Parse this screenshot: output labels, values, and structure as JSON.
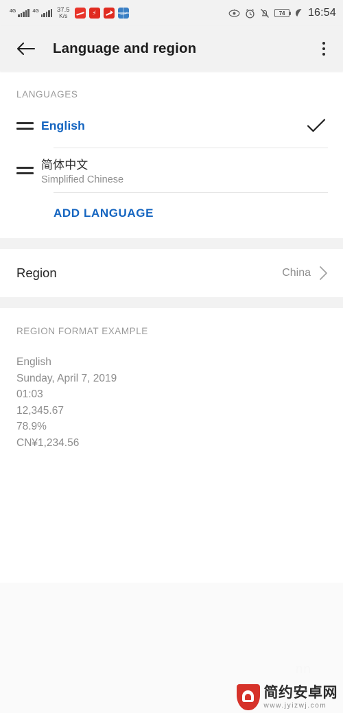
{
  "statusbar": {
    "signal1_label": "4G",
    "signal2_label": "4G",
    "netspeed_value": "37.5",
    "netspeed_unit": "K/s",
    "app_icons": [
      "stock-chart-icon",
      "stock-alert-icon",
      "trend-arrow-icon",
      "market-wave-icon"
    ],
    "eye_icon": "eye-comfort-icon",
    "alarm_icon": "alarm-clock-icon",
    "mute_icon": "bell-muted-icon",
    "battery_level": "74",
    "power_save_icon": "leaf-power-save-icon",
    "clock": "16:54"
  },
  "toolbar": {
    "back_icon": "back-arrow-icon",
    "title": "Language and region",
    "overflow_icon": "more-vertical-icon"
  },
  "languages": {
    "section_title": "LANGUAGES",
    "items": [
      {
        "name": "English",
        "subtitle": "",
        "selected": true,
        "handle_icon": "drag-handle-icon",
        "check_icon": "checkmark-icon"
      },
      {
        "name": "简体中文",
        "subtitle": "Simplified Chinese",
        "selected": false,
        "handle_icon": "drag-handle-icon",
        "check_icon": ""
      }
    ],
    "add_label": "ADD LANGUAGE"
  },
  "region": {
    "label": "Region",
    "value": "China",
    "chevron_icon": "chevron-right-icon"
  },
  "format_example": {
    "section_title": "REGION FORMAT EXAMPLE",
    "lines": [
      "English",
      "Sunday, April 7, 2019",
      "01:03",
      "12,345.67",
      "78.9%",
      "CN¥1,234.56"
    ]
  },
  "watermark": {
    "ghost_text": "nn",
    "logo_icon": "shield-android-logo-icon",
    "name": "简约安卓网",
    "url": "www.jyizwj.com"
  },
  "colors": {
    "accent_blue": "#1565c0",
    "background": "#f2f2f2",
    "card": "#ffffff",
    "muted_text": "#8e8e8e",
    "brand_red": "#d6322a"
  }
}
